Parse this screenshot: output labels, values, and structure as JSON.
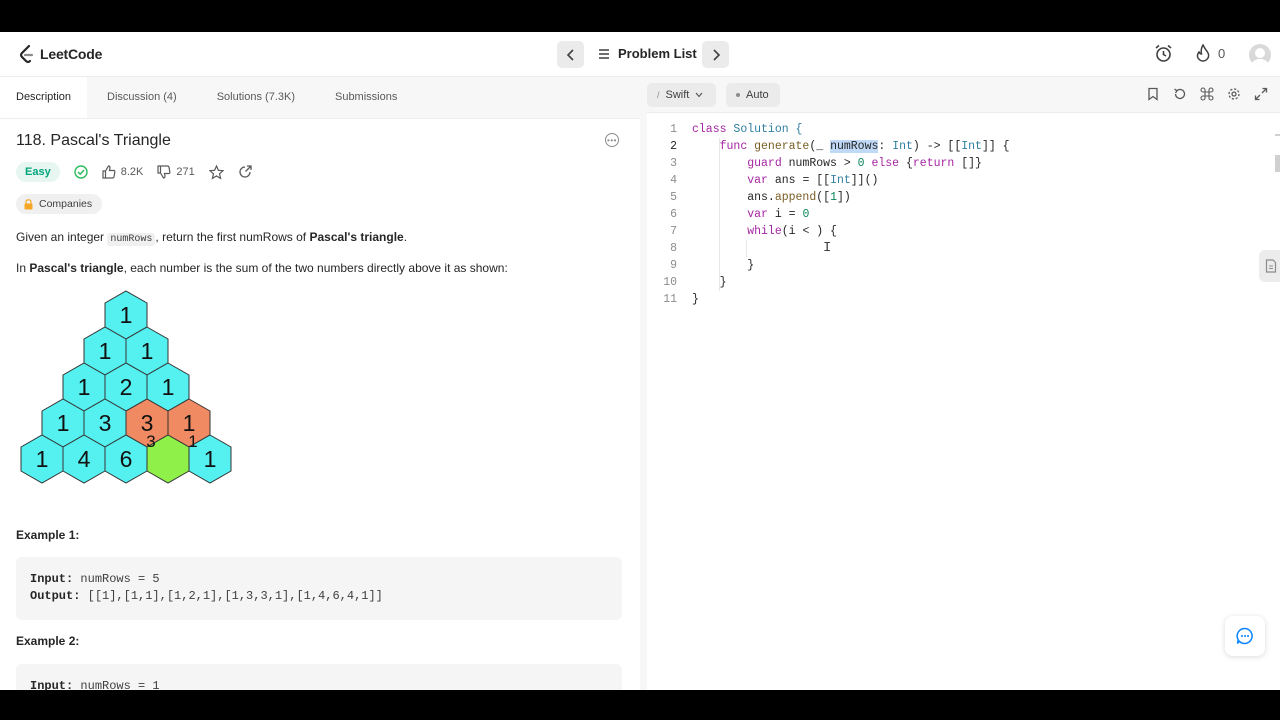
{
  "brand": {
    "name": "LeetCode"
  },
  "nav": {
    "problem_list_label": "Problem List",
    "streak_count": "0"
  },
  "tabs": [
    {
      "label": "Description"
    },
    {
      "label": "Discussion (4)"
    },
    {
      "label": "Solutions (7.3K)"
    },
    {
      "label": "Submissions"
    }
  ],
  "problem": {
    "title": "118. Pascal's Triangle",
    "difficulty": "Easy",
    "likes": "8.2K",
    "dislikes": "271",
    "companies_label": "Companies",
    "desc1_a": "Given an integer ",
    "desc1_code": "numRows",
    "desc1_b": ", return the first numRows of ",
    "desc1_bold": "Pascal's triangle",
    "desc1_c": ".",
    "desc2_a": "In ",
    "desc2_bold": "Pascal's triangle",
    "desc2_b": ", each number is the sum of the two numbers directly above it as shown:",
    "example1_title": "Example 1:",
    "example1_input_label": "Input:",
    "example1_input": " numRows = 5",
    "example1_output_label": "Output:",
    "example1_output": " [[1],[1,1],[1,2,1],[1,3,3,1],[1,4,6,4,1]]",
    "example2_title": "Example 2:",
    "example2_input_label": "Input:",
    "example2_input": " numRows = 1"
  },
  "triangle": {
    "rows": [
      [
        "1"
      ],
      [
        "1",
        "1"
      ],
      [
        "1",
        "2",
        "1"
      ],
      [
        "1",
        "3",
        "3",
        "1"
      ],
      [
        "1",
        "4",
        "6",
        "",
        "1"
      ]
    ],
    "overlay_small": [
      "3",
      "1"
    ],
    "colors": {
      "cyan": "#55f0f0",
      "orange": "#f08a63",
      "green": "#8ff04a",
      "stroke": "#333333"
    }
  },
  "editor": {
    "language": "Swift",
    "mode": "Auto",
    "lines": [
      {
        "num": "1"
      },
      {
        "num": "2"
      },
      {
        "num": "3"
      },
      {
        "num": "4"
      },
      {
        "num": "5"
      },
      {
        "num": "6"
      },
      {
        "num": "7"
      },
      {
        "num": "8"
      },
      {
        "num": "9"
      },
      {
        "num": "10"
      },
      {
        "num": "11"
      }
    ],
    "code": {
      "l1_class": "class",
      "l1_name": " Solution {",
      "l2_func": "func",
      "l2_name": " generate",
      "l2_a": "(_ ",
      "l2_sel": "numRows",
      "l2_b": ": ",
      "l2_int": "Int",
      "l2_c": ") -> [[",
      "l2_int2": "Int",
      "l2_d": "]] {",
      "l3_guard": "guard",
      "l3_a": " numRows > ",
      "l3_zero": "0",
      "l3_else": " else",
      "l3_b": " {",
      "l3_ret": "return",
      "l3_c": " []}",
      "l4_var": "var",
      "l4_a": " ans = [[",
      "l4_int": "Int",
      "l4_b": "]]()",
      "l5_a": "ans.",
      "l5_fn": "append",
      "l5_b": "([",
      "l5_one": "1",
      "l5_c": "])",
      "l6_var": "var",
      "l6_a": " i = ",
      "l6_zero": "0",
      "l7_while": "while",
      "l7_a": "(i < ) {",
      "l9": "}",
      "l10": "}",
      "l11": "}"
    }
  },
  "colors": {
    "accent_green": "#2cbb5d",
    "easy_green": "#00a57c"
  }
}
